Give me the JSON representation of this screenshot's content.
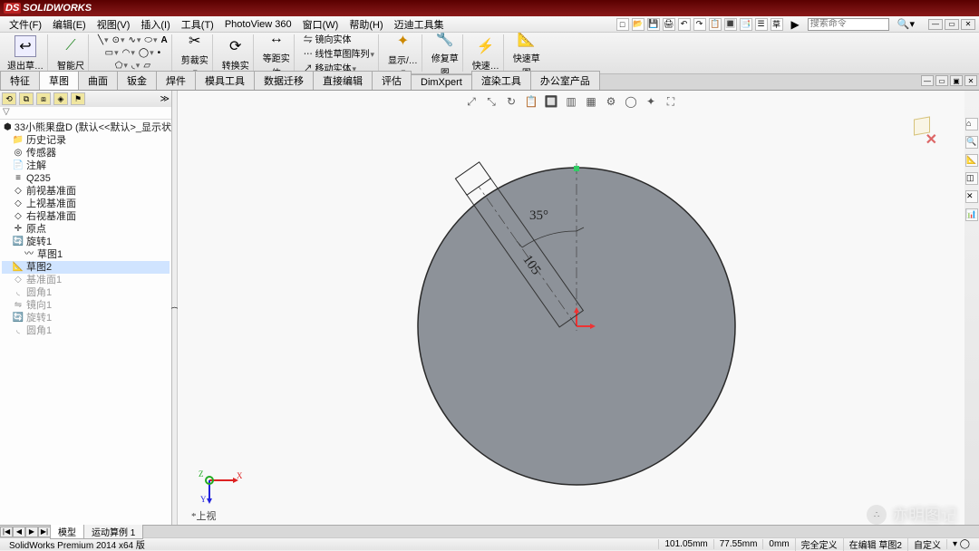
{
  "app": {
    "brand_ds": "DS",
    "brand_name": "SOLIDWORKS"
  },
  "menus": [
    "文件(F)",
    "编辑(E)",
    "视图(V)",
    "插入(I)",
    "工具(T)",
    "PhotoView 360",
    "窗口(W)",
    "帮助(H)",
    "迈迪工具集"
  ],
  "quick_icons": [
    "□",
    "📂",
    "💾",
    "🖨",
    "↶",
    "↷",
    "📋",
    "🔳",
    "📑",
    "☰",
    "草"
  ],
  "search": {
    "placeholder": "搜索命令"
  },
  "ribbon": {
    "exit": "退出草…",
    "smart": "智能尺",
    "trim": "剪裁实",
    "convert": "转换实",
    "offset": {
      "label": "等距实",
      "sub": "体"
    },
    "mirror": "镜向实体",
    "pattern": "线性草图阵列",
    "move": "移动实体",
    "display": "显示/…",
    "repair": {
      "label": "修复草",
      "sub": "图"
    },
    "rapid": "快速…",
    "rapid2": {
      "label": "快速草",
      "sub": "图"
    }
  },
  "tabs": [
    "特征",
    "草图",
    "曲面",
    "钣金",
    "焊件",
    "模具工具",
    "数据迁移",
    "直接编辑",
    "评估",
    "DimXpert",
    "渲染工具",
    "办公室产品"
  ],
  "active_tab_index": 1,
  "left_tabs": [
    "⟲",
    "⧉",
    "⧈",
    "◈",
    "⚑"
  ],
  "filter_icon": "▽",
  "tree": {
    "root": "33小熊果盘D  (默认<<默认>_显示状态",
    "items": [
      "历史记录",
      "传感器",
      "注解",
      "Q235",
      "前视基准面",
      "上视基准面",
      "右视基准面",
      "原点",
      "旋转1"
    ],
    "rev_child": "草图1",
    "active": "草图2",
    "grayed": [
      "基准面1",
      "圆角1",
      "镜向1",
      "旋转1",
      "圆角1"
    ]
  },
  "view_toolbar": [
    "⤢",
    "⤡",
    "↻",
    "📋",
    "🔲",
    "▥",
    "▦",
    "⚙",
    "◯",
    "✦",
    "⛶"
  ],
  "annotations": {
    "angle": "35°",
    "length": "105"
  },
  "triad": {
    "x": "X",
    "y": "Y",
    "z": "Z"
  },
  "view_label": "*上视",
  "bottom_tabs": {
    "scroll": [
      "|◀",
      "◀",
      "▶",
      "▶|"
    ],
    "tabs": [
      "模型",
      "运动算例 1"
    ]
  },
  "status": {
    "left": "SolidWorks Premium 2014 x64 版",
    "coord_x": "101.05mm",
    "coord_y": "77.55mm",
    "coord_z": "0mm",
    "def": "完全定义",
    "mode": "在编辑 草图2",
    "custom": "自定义",
    "tail": "▾  ◯"
  },
  "watermark": "亦明图记",
  "right_tools": [
    "⌂",
    "🔍",
    "📐",
    "◫",
    "✕",
    "📊"
  ]
}
